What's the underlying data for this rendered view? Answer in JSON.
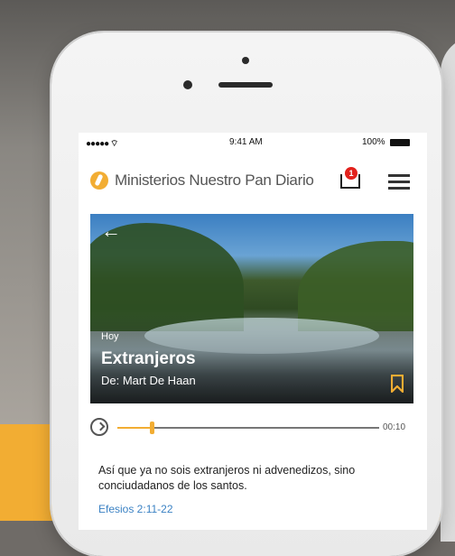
{
  "status_bar": {
    "signal": "●●●●● ⌔",
    "time": "9:41 AM",
    "battery": "100%"
  },
  "header": {
    "brand": "Ministerios Nuestro Pan Diario",
    "notification_count": "1"
  },
  "devotional": {
    "kicker": "Hoy",
    "title": "Extranjeros",
    "author": "De: Mart De Haan",
    "back_icon": "←"
  },
  "player": {
    "duration": "00:10",
    "progress": 0.13
  },
  "verse": {
    "text": "Así que ya no sois extranjeros ni advenedizos, sino conciudadanos de los santos.",
    "reference": "Efesios 2:11-22"
  },
  "colors": {
    "accent": "#f2ad33",
    "link": "#3b82c4",
    "badge": "#e2211c"
  }
}
